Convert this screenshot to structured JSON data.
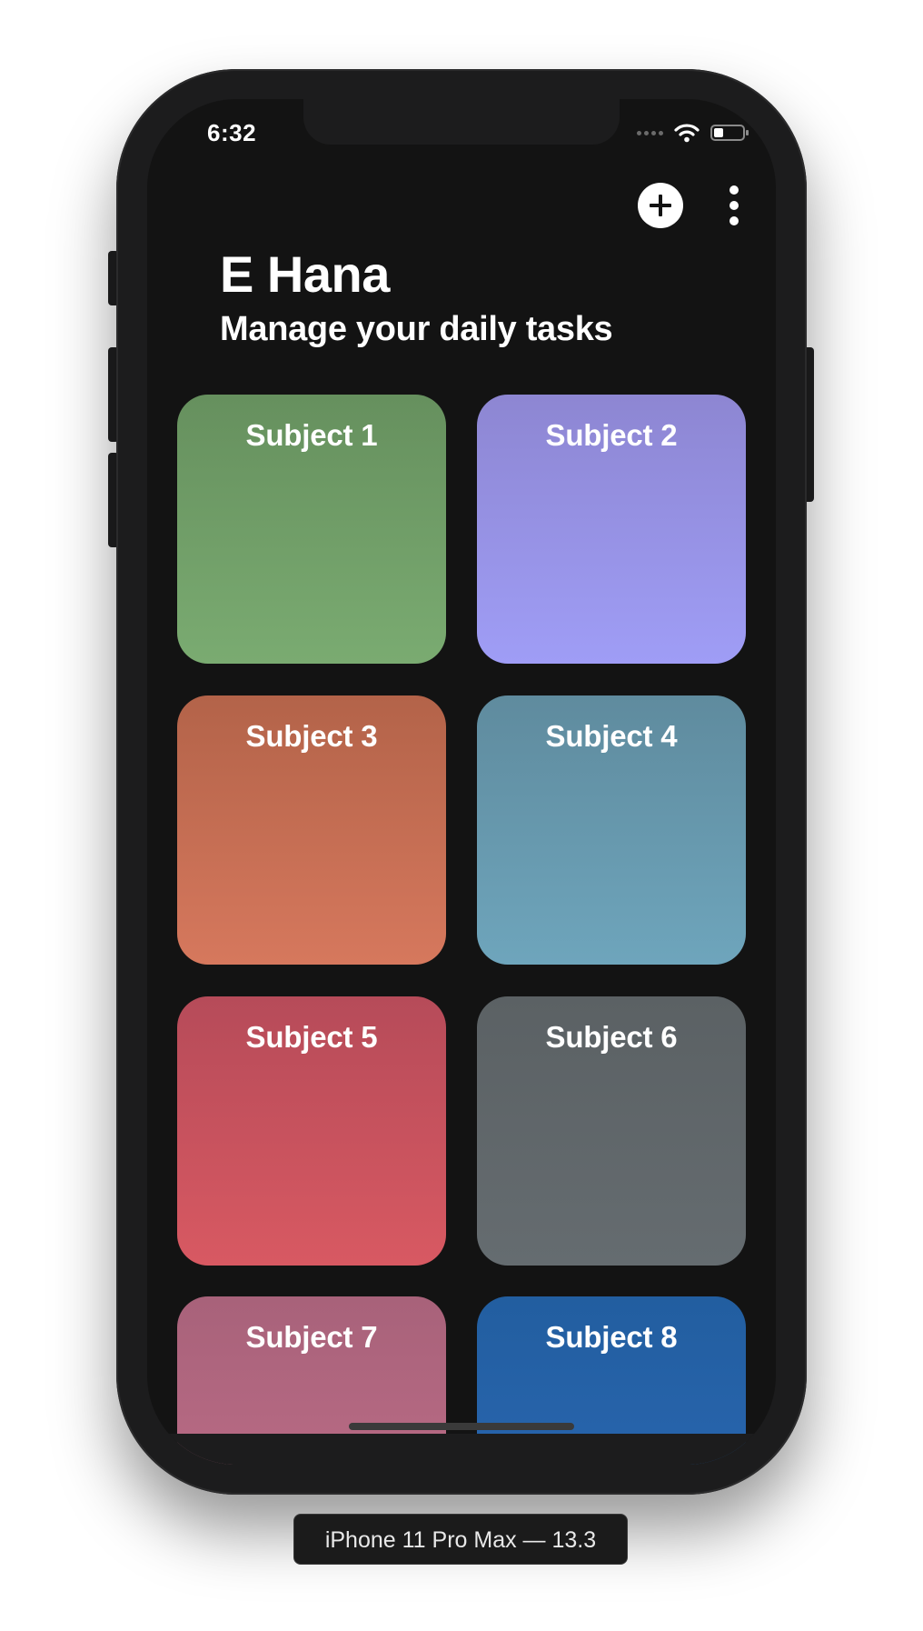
{
  "status_bar": {
    "time": "6:32"
  },
  "header": {
    "title": "E Hana",
    "subtitle": "Manage your daily tasks"
  },
  "actions": {
    "add_icon": "plus-circle-icon",
    "more_icon": "more-vertical-icon"
  },
  "subjects": [
    {
      "label": "Subject 1",
      "color": "#6f9b66"
    },
    {
      "label": "Subject 2",
      "color": "#9692e6"
    },
    {
      "label": "Subject 3",
      "color": "#c66e54"
    },
    {
      "label": "Subject 4",
      "color": "#6798ad"
    },
    {
      "label": "Subject 5",
      "color": "#c8525e"
    },
    {
      "label": "Subject 6",
      "color": "#60676a"
    },
    {
      "label": "Subject 7",
      "color": "#b46882"
    },
    {
      "label": "Subject 8",
      "color": "#2663aa"
    }
  ],
  "simulator": {
    "device_label": "iPhone 11 Pro Max — 13.3"
  }
}
